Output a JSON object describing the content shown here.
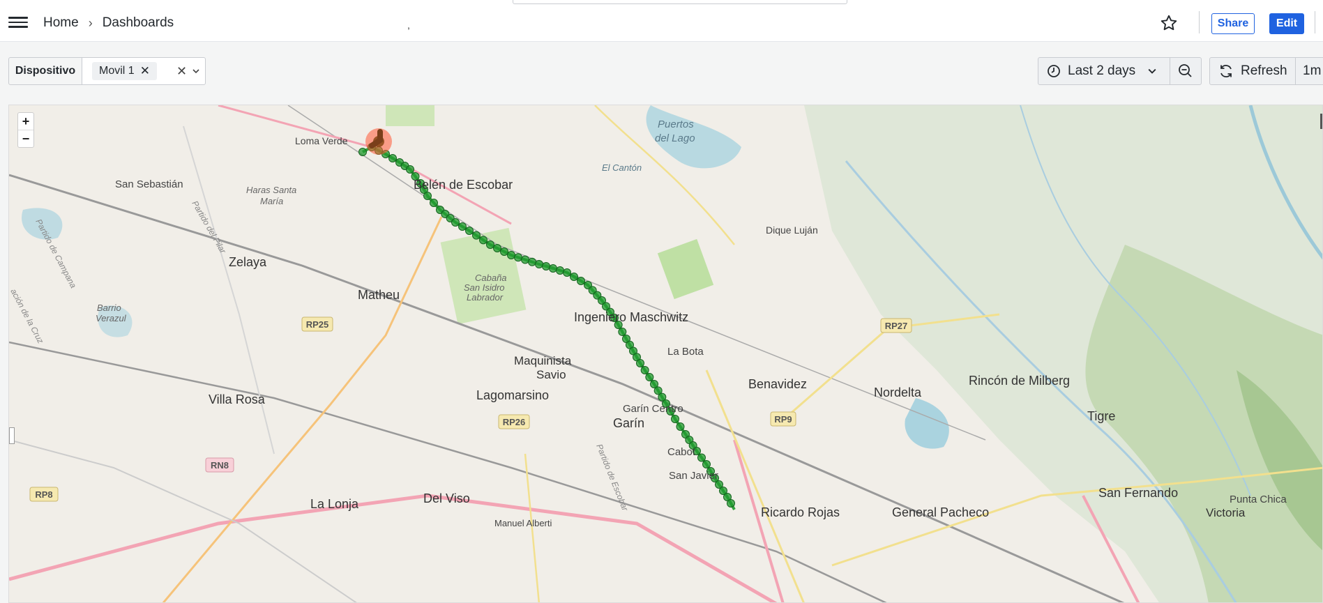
{
  "topbar": {
    "breadcrumb": [
      "Home",
      "Dashboards"
    ],
    "comma": ",",
    "share_label": "Share",
    "edit_label": "Edit"
  },
  "variables": {
    "label": "Dispositivo",
    "selected": "Movil 1"
  },
  "time": {
    "range_label": "Last 2 days",
    "refresh_label": "Refresh",
    "interval": "1m"
  },
  "map": {
    "zoom_in": "+",
    "zoom_out": "−",
    "places": [
      "Loma Verde",
      "San Sebastián",
      "Haras Santa",
      "María",
      "Belén de Escobar",
      "Puertos",
      "del Lago",
      "El Cantón",
      "Dique Luján",
      "Zelaya",
      "Matheu",
      "Cabaña",
      "San Isidro",
      "Labrador",
      "Barrio",
      "Verazul",
      "Ingeniero Maschwitz",
      "La Bota",
      "Maquinista",
      "Savio",
      "Lagomarsino",
      "Benavidez",
      "Nordelta",
      "Rincón de Milberg",
      "Villa Rosa",
      "Garín Centro",
      "Garín",
      "Tigre",
      "Cabot",
      "San Javier",
      "La Lonja",
      "Del Viso",
      "Ricardo Rojas",
      "General Pacheco",
      "San Fernando",
      "Victoria",
      "Punta Chica",
      "Manuel Alberti",
      "Partido del Pilar",
      "Partido de Campana",
      "ación de la Cruz",
      "Partido de Escobar"
    ],
    "routes": [
      "RP25",
      "RP26",
      "RP27",
      "RP9",
      "RN8",
      "RP8"
    ],
    "track_color": "#1f9a2e",
    "start_marker_color": "#ff5a36"
  }
}
